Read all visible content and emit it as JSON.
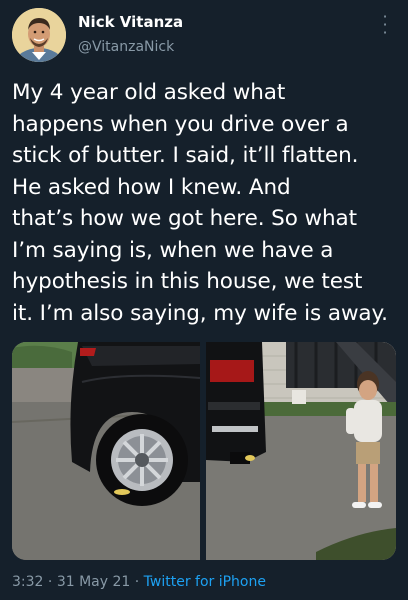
{
  "author": {
    "name": "Nick Vitanza",
    "handle": "@VitanzaNick"
  },
  "tweet": {
    "lines": [
      "My 4 year old asked what",
      "happens when you drive over a",
      "stick of butter. I said, it’ll flatten.",
      "He asked how I knew. And",
      "that’s how we got here. So what",
      "I’m saying is, when we have a",
      "hypothesis in this house, we test",
      "it. I’m also saying, my wife is away."
    ]
  },
  "media": {
    "photos": [
      {
        "description": "rear-wheel-of-black-suv-on-driveway"
      },
      {
        "description": "child-watching-suv-parked-by-house"
      }
    ]
  },
  "meta": {
    "time": "3:32",
    "separator": "·",
    "date": "31 May 21",
    "source": "Twitter for iPhone"
  },
  "icons": {
    "more": "more-vertical-icon"
  },
  "colors": {
    "background": "#15202b",
    "secondary_text": "#8899a6",
    "link": "#1da1f2"
  }
}
